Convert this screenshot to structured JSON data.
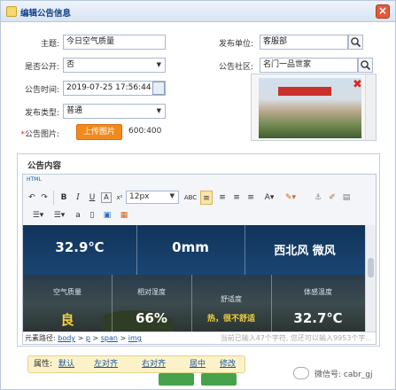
{
  "window": {
    "title": "编辑公告信息",
    "close_label": "×"
  },
  "form": {
    "subject_label": "主题:",
    "subject_value": "今日空气质量",
    "publisher_label": "发布单位:",
    "publisher_value": "客服部",
    "is_public_label": "是否公开:",
    "is_public_value": "否",
    "community_label": "公告社区:",
    "community_value": "名门一品世家",
    "time_label": "公告时间:",
    "time_value": "2019-07-25 17:56:44",
    "type_label": "发布类型:",
    "type_value": "普通",
    "image_label": "公告图片:",
    "image_required_mark": "*",
    "upload_label": "上传图片",
    "image_size": "600:400"
  },
  "editor": {
    "section_title": "公告内容",
    "toolbar": {
      "html_label": "HTML",
      "bold": "B",
      "italic": "I",
      "underline": "U",
      "strike": "A",
      "font_size": "12px",
      "abc": "ABC"
    },
    "weather": {
      "temperature": "32.9℃",
      "rainfall": "0mm",
      "wind": "西北风 微风",
      "air_quality_label": "空气质量",
      "air_quality_value": "良",
      "humidity_label": "相对湿度",
      "humidity_value": "66%",
      "comfort_label": "舒适度",
      "comfort_value": "热，很不舒适",
      "feels_label": "体感温度",
      "feels_value": "32.7℃"
    },
    "path_label": "元素路径:",
    "path_items": [
      "body",
      "p",
      "span",
      "img"
    ],
    "path_sep": " > ",
    "char_count": "当前已输入47个字符, 您还可以输入9953个字..."
  },
  "attr_bar": {
    "label": "属性:",
    "items": [
      "默认",
      "左对齐",
      "右对齐",
      "居中",
      "修改"
    ]
  },
  "watermark": "微信号: cabr_gj",
  "colors": {
    "accent": "#f08a1c",
    "link": "#1c57a5",
    "title": "#15428b",
    "close": "#e05a3c"
  }
}
